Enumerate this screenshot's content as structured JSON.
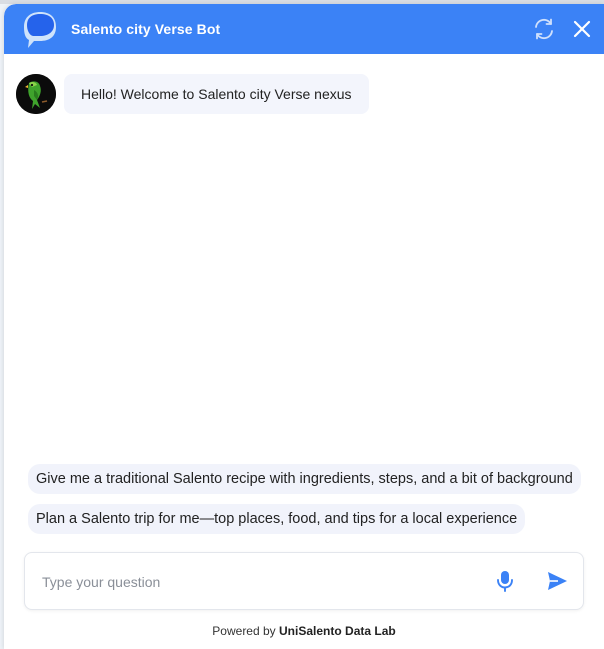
{
  "header": {
    "title": "Salento city Verse Bot"
  },
  "messages": [
    {
      "sender": "bot",
      "text": "Hello! Welcome to Salento city Verse nexus"
    }
  ],
  "suggestions": [
    "Give me a traditional Salento recipe with ingredients, steps, and a bit of background",
    "Plan a Salento trip for me—top places, food, and tips for a local experience"
  ],
  "input": {
    "value": "",
    "placeholder": "Type your question"
  },
  "footer": {
    "prefix": "Powered by",
    "brand": "UniSalento Data Lab"
  },
  "icons": {
    "logo": "chat-bubble-icon",
    "refresh": "refresh-icon",
    "close": "close-icon",
    "avatar": "parrot-icon",
    "mic": "microphone-icon",
    "send": "send-icon"
  },
  "colors": {
    "accent": "#3b82f6",
    "bubble_bg": "#f3f5fc",
    "suggestion_bg": "#f1f3fb",
    "header_text": "#ffffff"
  }
}
